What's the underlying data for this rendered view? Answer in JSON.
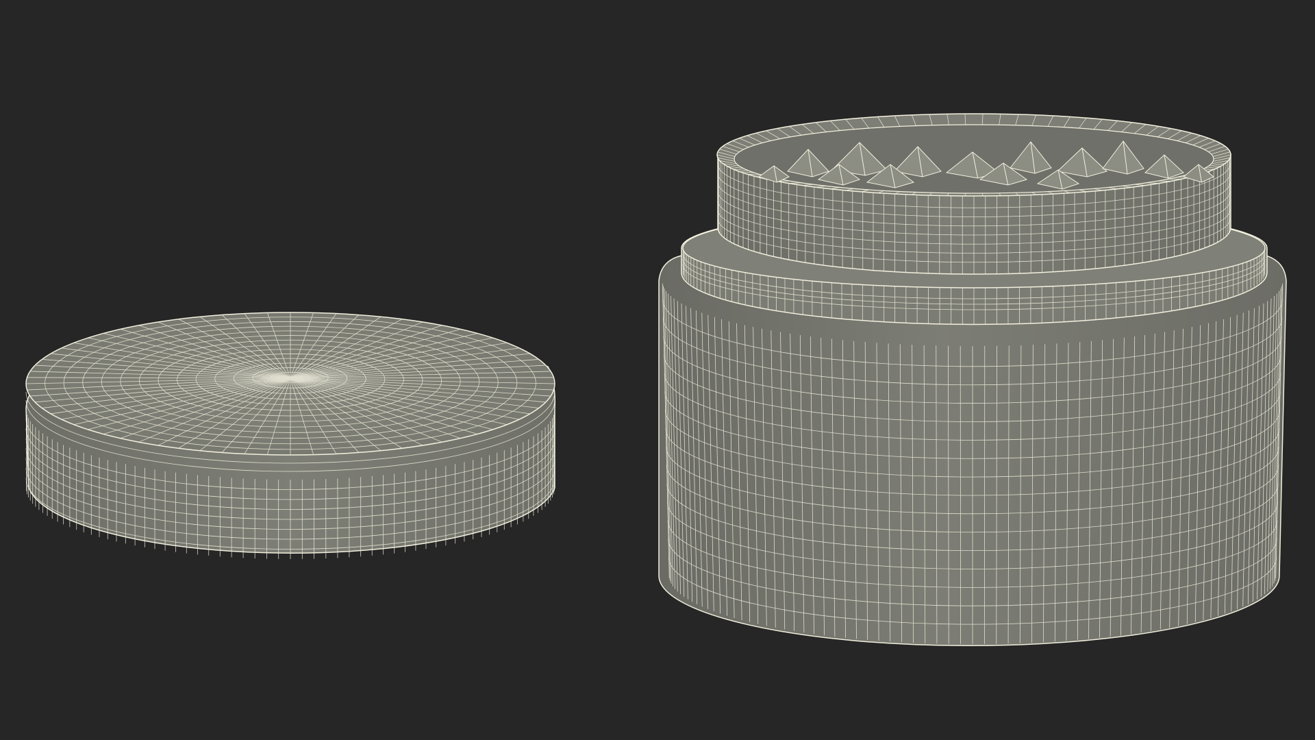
{
  "scene": {
    "background_color": "#262626",
    "mesh_fill_color": "#7a7b72",
    "mesh_shadow_color": "#5f605a",
    "wireframe_color": "#f2f0df",
    "objects": [
      {
        "id": "lid",
        "description_name": "grinder-lid"
      },
      {
        "id": "body",
        "description_name": "grinder-body"
      }
    ]
  }
}
